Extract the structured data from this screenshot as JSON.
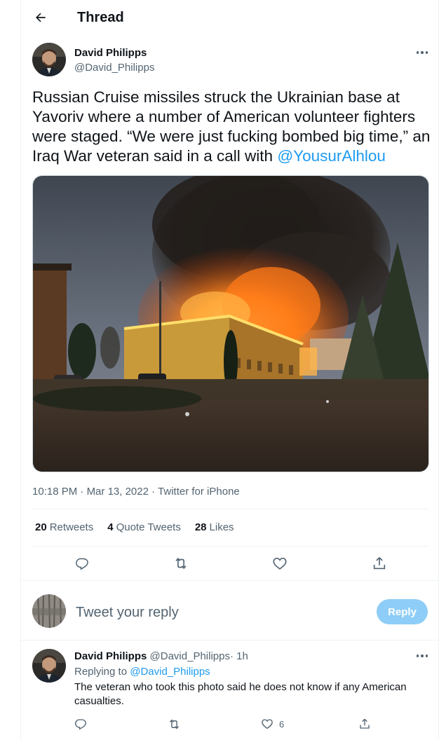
{
  "header": {
    "title": "Thread"
  },
  "tweet": {
    "author_name": "David Philipps",
    "author_handle": "@David_Philipps",
    "text_before_mention": "Russian Cruise missiles struck the Ukrainian base at Yavoriv where a number of American volunteer fighters were staged. “We were just fucking bombed big time,” an Iraq War veteran said in a call with",
    "mention": "@YousurAlhlou",
    "time": "10:18 PM",
    "date": "Mar 13, 2022",
    "source": "Twitter for iPhone",
    "separator": "·",
    "stats": {
      "retweets_count": "20",
      "retweets_label": "Retweets",
      "quotes_count": "4",
      "quotes_label": "Quote Tweets",
      "likes_count": "28",
      "likes_label": "Likes"
    }
  },
  "composer": {
    "placeholder": "Tweet your reply",
    "reply_button": "Reply"
  },
  "reply": {
    "author_name": "David Philipps",
    "author_handle": "@David_Philipps",
    "separator": "·",
    "age": "1h",
    "replying_to_label": "Replying to",
    "replying_to_handle": "@David_Philipps",
    "text": "The veteran who took this photo said he does not know if any American casualties.",
    "like_count": "6"
  },
  "colors": {
    "accent": "#1d9bf0",
    "reply_button_disabled": "#8ecdf7",
    "secondary_text": "#536471",
    "divider": "#eff3f4"
  },
  "icons": [
    "back-arrow-icon",
    "more-dots-icon",
    "reply-icon",
    "retweet-icon",
    "like-icon",
    "share-icon"
  ]
}
